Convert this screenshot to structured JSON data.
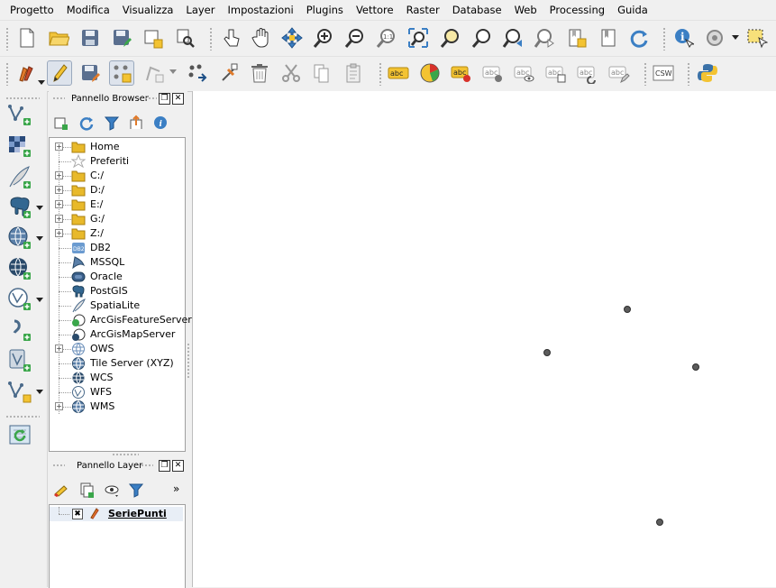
{
  "menu": [
    "Progetto",
    "Modifica",
    "Visualizza",
    "Layer",
    "Impostazioni",
    "Plugins",
    "Vettore",
    "Raster",
    "Database",
    "Web",
    "Processing",
    "Guida"
  ],
  "toolbar1_icons": [
    "new-project-icon",
    "open-project-icon",
    "save-project-icon",
    "save-as-icon",
    "new-print-layout-icon",
    "layout-manager-icon",
    "touch-icon",
    "pan-icon",
    "pan-to-selection-icon",
    "zoom-in-icon",
    "zoom-out-icon",
    "zoom-native-icon",
    "zoom-full-icon",
    "zoom-selection-icon",
    "zoom-layer-icon",
    "zoom-last-icon",
    "zoom-next-icon",
    "new-bookmark-icon",
    "show-bookmarks-icon",
    "refresh-icon",
    "identify-icon",
    "action-icon",
    "select-icon"
  ],
  "toolbar2_icons": [
    "current-edits-icon",
    "toggle-editing-icon",
    "save-edits-icon",
    "add-feature-icon",
    "vertex-tool-icon",
    "move-feature-icon",
    "node-tool-icon",
    "delete-selected-icon",
    "cut-features-icon",
    "copy-features-icon",
    "paste-features-icon",
    "label-abc-icon",
    "diagram-icon",
    "pin-labels-icon",
    "show-hide-labels-icon",
    "preview-labels-icon",
    "move-label-icon",
    "rotate-label-icon",
    "change-label-icon",
    "csw-icon",
    "python-icon"
  ],
  "csw_label": "CSW",
  "abc_label": "abc",
  "left_toolbar_icons": [
    "add-vector-layer-icon",
    "add-raster-layer-icon",
    "add-spatialite-layer-icon",
    "add-postgis-layer-icon",
    "add-wms-layer-icon",
    "add-wcs-layer-icon",
    "add-wfs-layer-icon",
    "add-delimited-text-icon",
    "add-virtual-layer-icon",
    "new-shapefile-icon",
    "refresh-layers-icon"
  ],
  "browser_panel": {
    "title": "Pannello Browser",
    "tools": [
      "add-selected-icon",
      "refresh-icon",
      "filter-icon",
      "collapse-all-icon",
      "properties-icon"
    ],
    "items": [
      {
        "label": "Home",
        "icon": "folder-icon",
        "expandable": true
      },
      {
        "label": "Preferiti",
        "icon": "star-icon",
        "expandable": false
      },
      {
        "label": "C:/",
        "icon": "folder-icon",
        "expandable": true
      },
      {
        "label": "D:/",
        "icon": "folder-icon",
        "expandable": true
      },
      {
        "label": "E:/",
        "icon": "folder-icon",
        "expandable": true
      },
      {
        "label": "G:/",
        "icon": "folder-icon",
        "expandable": true
      },
      {
        "label": "Z:/",
        "icon": "folder-icon",
        "expandable": true
      },
      {
        "label": "DB2",
        "icon": "db2-icon",
        "expandable": false
      },
      {
        "label": "MSSQL",
        "icon": "mssql-icon",
        "expandable": false
      },
      {
        "label": "Oracle",
        "icon": "oracle-icon",
        "expandable": false
      },
      {
        "label": "PostGIS",
        "icon": "postgis-icon",
        "expandable": false
      },
      {
        "label": "SpatiaLite",
        "icon": "spatialite-icon",
        "expandable": false
      },
      {
        "label": "ArcGisFeatureServer",
        "icon": "arcgis-feature-icon",
        "expandable": false
      },
      {
        "label": "ArcGisMapServer",
        "icon": "arcgis-map-icon",
        "expandable": false
      },
      {
        "label": "OWS",
        "icon": "ows-icon",
        "expandable": true
      },
      {
        "label": "Tile Server (XYZ)",
        "icon": "tile-server-icon",
        "expandable": false
      },
      {
        "label": "WCS",
        "icon": "wcs-icon",
        "expandable": false
      },
      {
        "label": "WFS",
        "icon": "wfs-icon",
        "expandable": false
      },
      {
        "label": "WMS",
        "icon": "wms-icon",
        "expandable": true
      }
    ]
  },
  "layer_panel": {
    "title": "Pannello Layer",
    "tools": [
      "style-icon",
      "add-group-icon",
      "visibility-icon",
      "filter-icon"
    ],
    "more": "»",
    "layers": [
      {
        "name": "SeriePunti",
        "checked": true,
        "icon": "point-layer-icon"
      }
    ]
  },
  "map_canvas": {
    "background": "#ffffff",
    "point_color": "#5c5c5c",
    "point_count": 4
  },
  "colors": {
    "folder": "#e8b92a",
    "accent": "#3b7fc4",
    "green_plus": "#3aa64a"
  }
}
